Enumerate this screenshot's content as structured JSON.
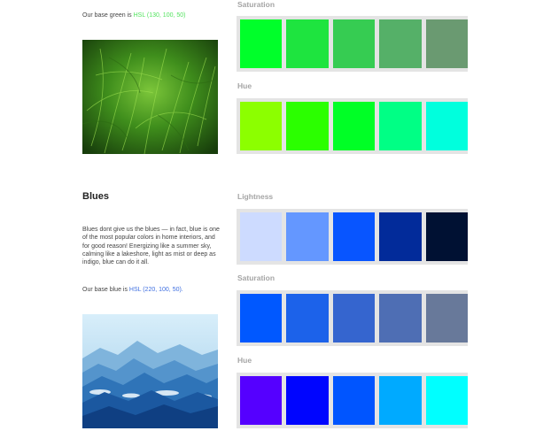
{
  "greens": {
    "intro_prefix": "Our base green is ",
    "intro_link": "HSL (130, 100, 50)",
    "saturation": {
      "label": "Saturation",
      "swatches": [
        "#00ff2a",
        "#1ee43f",
        "#36cc52",
        "#55b068",
        "#6a9a71"
      ]
    },
    "hue": {
      "label": "Hue",
      "swatches": [
        "#8cff00",
        "#2bff00",
        "#00ff26",
        "#00ff85",
        "#00ffdd"
      ]
    }
  },
  "blues": {
    "title": "Blues",
    "description": "Blues dont give us the blues — in fact, blue is one of the most popular colors in home interiors, and for good reason! Energizing like a summer sky, calming like a lakeshore, light as mist or deep as indigo, blue can do it all.",
    "intro_prefix": "Our base blue is ",
    "intro_link": "HSL (220, 100, 50).",
    "lightness": {
      "label": "Lightness",
      "swatches": [
        "#cddbff",
        "#6497ff",
        "#0855ff",
        "#022b9a",
        "#001133"
      ]
    },
    "saturation": {
      "label": "Saturation",
      "swatches": [
        "#0058ff",
        "#1c62ea",
        "#3565cf",
        "#4e6eb4",
        "#68799a"
      ]
    },
    "hue": {
      "label": "Hue",
      "swatches": [
        "#5500ff",
        "#0005ff",
        "#0055ff",
        "#00aaff",
        "#00ffff"
      ]
    }
  }
}
